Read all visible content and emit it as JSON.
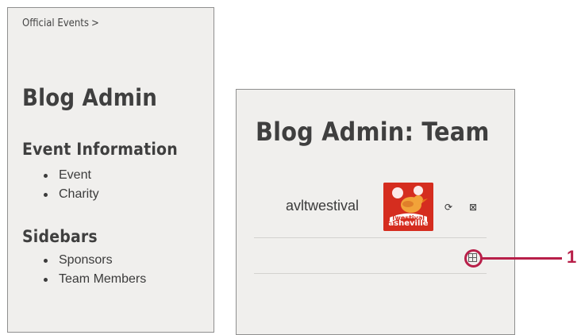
{
  "breadcrumb": {
    "link": "Official Events",
    "separator": ">"
  },
  "left_panel": {
    "title": "Blog Admin",
    "sections": [
      {
        "heading": "Event Information",
        "items": [
          "Event",
          "Charity"
        ]
      },
      {
        "heading": "Sidebars",
        "items": [
          "Sponsors",
          "Team Members"
        ]
      }
    ]
  },
  "right_panel": {
    "title": "Blog Admin: Team",
    "member": {
      "name": "avltwestival",
      "avatar_icon": "twestival-asheville-logo",
      "avatar_text": "asheville",
      "actions": [
        "refresh-icon",
        "remove-icon"
      ]
    },
    "add_icon": "add-member-icon"
  },
  "annotation": {
    "number": "1",
    "color": "#b81f49"
  },
  "colors": {
    "panel_bg": "#f0efed",
    "panel_border": "#8f8f8f",
    "text": "#3a3a3a",
    "accent": "#b81f49",
    "avatar_bg": "#d52d1f"
  }
}
